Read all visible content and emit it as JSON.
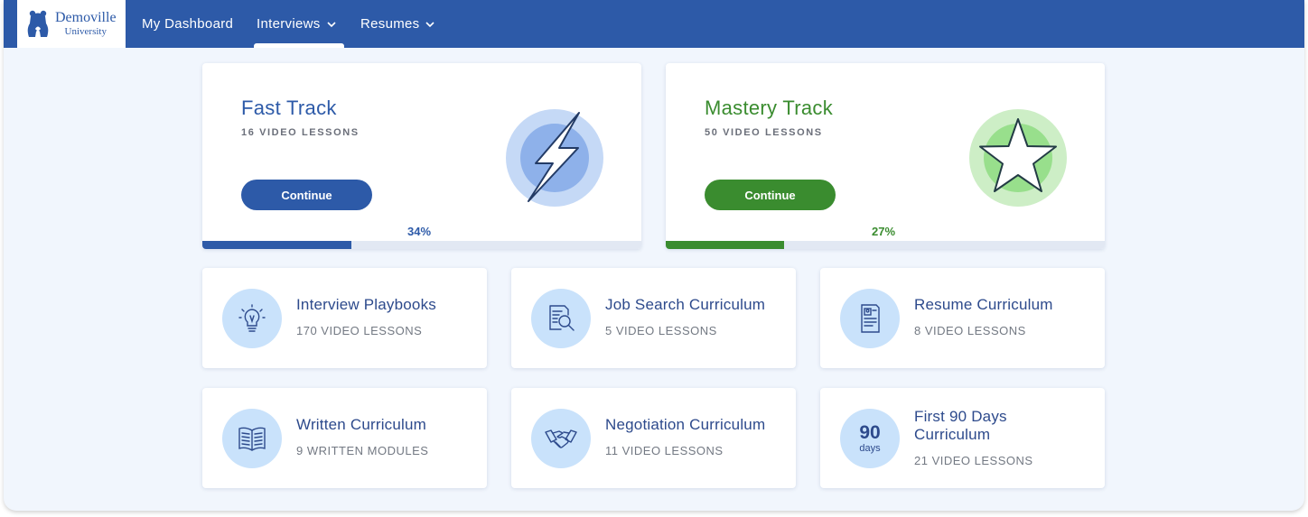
{
  "logo": {
    "name": "Demoville",
    "sub": "University"
  },
  "nav": {
    "dashboard": "My Dashboard",
    "interviews": "Interviews",
    "resumes": "Resumes"
  },
  "tracks": [
    {
      "title": "Fast Track",
      "subtitle": "16 VIDEO LESSONS",
      "button": "Continue",
      "percent_label": "34%",
      "progress": 0.34,
      "color": "#2d5aa8",
      "icon": "lightning-bolt-icon"
    },
    {
      "title": "Mastery Track",
      "subtitle": "50 VIDEO LESSONS",
      "button": "Continue",
      "percent_label": "27%",
      "progress": 0.27,
      "color": "#3a8c2f",
      "icon": "star-icon"
    }
  ],
  "curricula": [
    {
      "title": "Interview Playbooks",
      "subtitle": "170 VIDEO LESSONS",
      "icon": "lightbulb-icon"
    },
    {
      "title": "Job Search Curriculum",
      "subtitle": "5 VIDEO LESSONS",
      "icon": "document-search-icon"
    },
    {
      "title": "Resume Curriculum",
      "subtitle": "8 VIDEO LESSONS",
      "icon": "resume-icon"
    },
    {
      "title": "Written Curriculum",
      "subtitle": "9 WRITTEN MODULES",
      "icon": "open-book-icon"
    },
    {
      "title": "Negotiation Curriculum",
      "subtitle": "11 VIDEO LESSONS",
      "icon": "handshake-icon"
    },
    {
      "title": "First 90 Days Curriculum",
      "subtitle": "21 VIDEO LESSONS",
      "icon": "90-days-icon",
      "badge_number": "90",
      "badge_unit": "days"
    }
  ],
  "colors": {
    "primary": "#2d5aa8",
    "success": "#3a8c2f",
    "page_bg": "#f1f6fd",
    "icon_bg": "#c9e2fb"
  }
}
